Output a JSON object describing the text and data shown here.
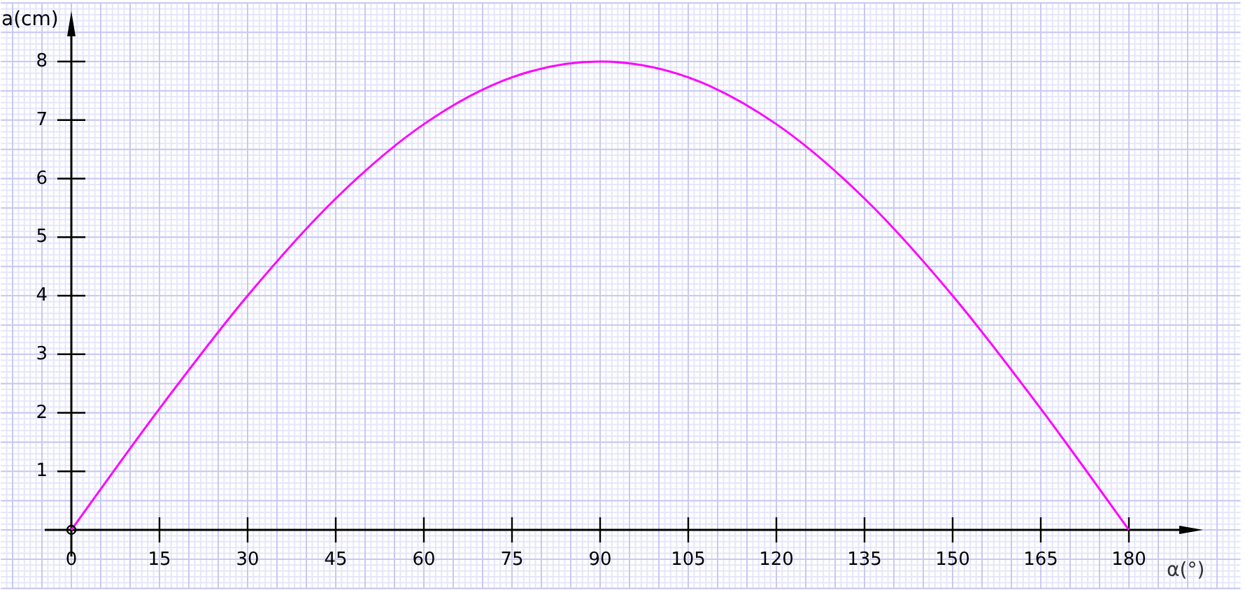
{
  "chart_data": {
    "type": "line",
    "xlabel": "α(°)",
    "ylabel": "a(cm)",
    "x": [
      0,
      15,
      30,
      45,
      60,
      75,
      90,
      105,
      120,
      135,
      150,
      165,
      180
    ],
    "series": [
      {
        "color": "#ff00ff",
        "values": [
          0,
          2.07,
          4,
          5.66,
          6.93,
          7.73,
          8,
          7.73,
          6.93,
          5.66,
          4,
          2.07,
          0
        ]
      }
    ],
    "xlim": [
      -12,
      199
    ],
    "ylim": [
      -1,
      9
    ],
    "grid": true,
    "xticks": [
      0,
      15,
      30,
      45,
      60,
      75,
      90,
      105,
      120,
      135,
      150,
      165,
      180
    ],
    "yticks": [
      1,
      2,
      3,
      4,
      5,
      6,
      7,
      8
    ]
  }
}
